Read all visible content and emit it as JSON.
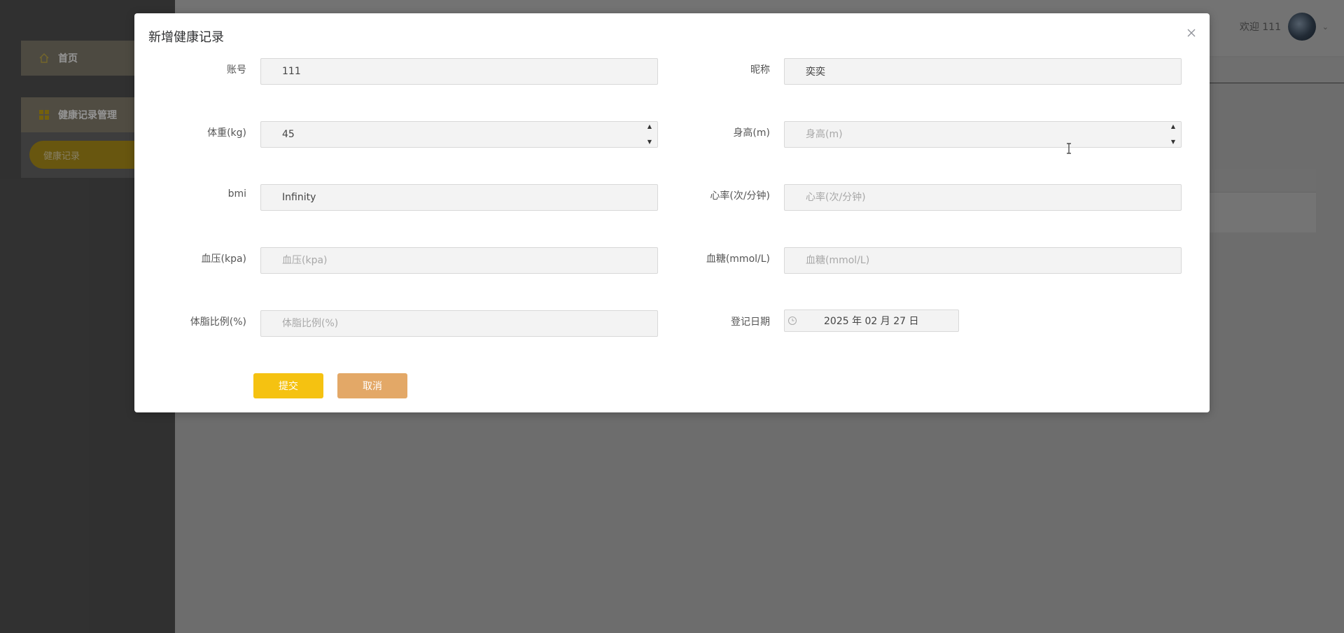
{
  "sidebar": {
    "items": [
      {
        "label": "首页",
        "icon": "home-icon"
      },
      {
        "label": "健康记录管理",
        "icon": "grid-icon",
        "children": [
          {
            "label": "健康记录"
          }
        ]
      }
    ]
  },
  "header": {
    "welcome": "欢迎 111"
  },
  "dialog": {
    "title": "新增健康记录",
    "fields": {
      "account": {
        "label": "账号",
        "value": "111",
        "placeholder": ""
      },
      "nickname": {
        "label": "昵称",
        "value": "奕奕",
        "placeholder": ""
      },
      "weight": {
        "label": "体重(kg)",
        "value": "45",
        "placeholder": ""
      },
      "height": {
        "label": "身高(m)",
        "value": "",
        "placeholder": "身高(m)"
      },
      "bmi": {
        "label": "bmi",
        "value": "Infinity",
        "placeholder": ""
      },
      "heart_rate": {
        "label": "心率(次/分钟)",
        "value": "",
        "placeholder": "心率(次/分钟)"
      },
      "blood_pressure": {
        "label": "血压(kpa)",
        "value": "",
        "placeholder": "血压(kpa)"
      },
      "blood_sugar": {
        "label": "血糖(mmol/L)",
        "value": "",
        "placeholder": "血糖(mmol/L)"
      },
      "body_fat": {
        "label": "体脂比例(%)",
        "value": "",
        "placeholder": "体脂比例(%)"
      },
      "record_date": {
        "label": "登记日期",
        "value": "2025 年 02 月 27 日"
      }
    },
    "buttons": {
      "submit": "提交",
      "cancel": "取消"
    }
  },
  "colors": {
    "accent": "#f5c211",
    "cancel": "#e3a867",
    "sidebar_bg": "#545454"
  }
}
